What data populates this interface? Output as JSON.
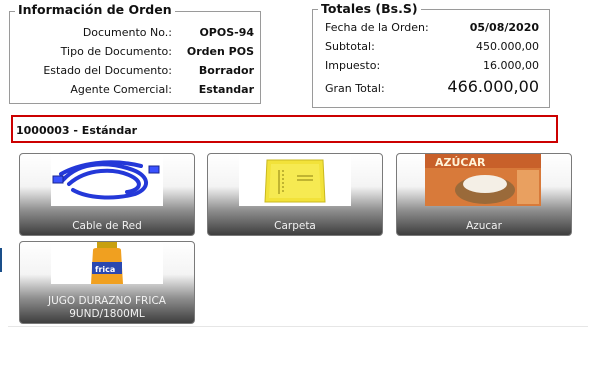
{
  "order_info": {
    "legend": "Información de Orden",
    "rows": [
      {
        "label": "Documento No.:",
        "value": "OPOS-94"
      },
      {
        "label": "Tipo de Documento:",
        "value": "Orden POS"
      },
      {
        "label": "Estado del Documento:",
        "value": "Borrador"
      },
      {
        "label": "Agente Comercial:",
        "value": "Estandar"
      }
    ]
  },
  "totals": {
    "legend": "Totales (Bs.S)",
    "date_label": "Fecha de la Orden:",
    "date_value": "05/08/2020",
    "subtotal_label": "Subtotal:",
    "subtotal_value": "450.000,00",
    "tax_label": "Impuesto:",
    "tax_value": "16.000,00",
    "grand_label": "Gran Total:",
    "grand_value": "466.000,00"
  },
  "partner": {
    "text": "1000003 - Estándar"
  },
  "products": [
    {
      "name": "Cable de Red"
    },
    {
      "name": "Carpeta"
    },
    {
      "name": "Azucar"
    },
    {
      "name_line1": "JUGO DURAZNO FRICA",
      "name_line2": "9UND/1800ML"
    }
  ],
  "colors": {
    "partner_border": "#cc0000",
    "accent": "#1a4f8a"
  }
}
